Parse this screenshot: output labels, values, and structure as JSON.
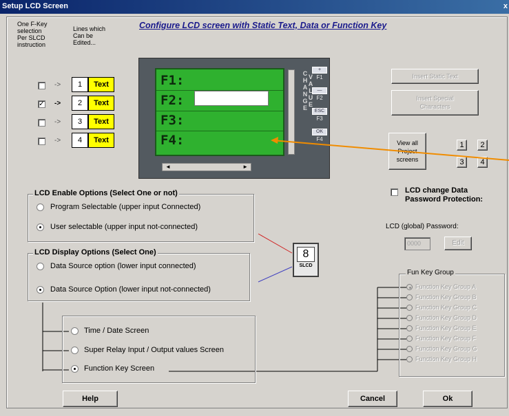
{
  "window": {
    "title": "Setup LCD Screen",
    "close_glyph": "x"
  },
  "header": {
    "fkey_note": [
      "One F-Key",
      "selection",
      "Per SLCD",
      "instruction"
    ],
    "lines_note": [
      "Lines which",
      "Can be",
      "Edited..."
    ],
    "main_title": "Configure LCD screen with Static Text, Data or Function Key"
  },
  "lines": [
    {
      "checked": false,
      "num": "1",
      "label": "Text"
    },
    {
      "checked": true,
      "num": "2",
      "label": "Text"
    },
    {
      "checked": false,
      "num": "3",
      "label": "Text"
    },
    {
      "checked": false,
      "num": "4",
      "label": "Text"
    }
  ],
  "lcd": {
    "lines": [
      "F1:",
      "F2:",
      "F3:",
      "F4:"
    ],
    "change_letters": [
      "C",
      "H",
      "A",
      "N",
      "G",
      "E"
    ],
    "value_letters": [
      "V",
      "A",
      "L",
      "U",
      "E"
    ],
    "fkeys": [
      "F1",
      "F2",
      "F3",
      "F4"
    ],
    "fkey_buttons": [
      "+",
      "—",
      "ESC",
      "OK"
    ],
    "hscroll_glyphs": [
      "◄",
      "►"
    ]
  },
  "right_buttons": {
    "insert_static": "Insert Static Text",
    "insert_special": [
      "Insert Special",
      "Characters"
    ],
    "view_all": [
      "View all",
      "Project",
      "screens"
    ],
    "screen_nums": [
      "1",
      "2",
      "3",
      "4"
    ]
  },
  "password": {
    "change_label": [
      "LCD change Data",
      "Password Protection:"
    ],
    "global_label": "LCD (global) Password:",
    "value": "0000",
    "edit_label": "Edit"
  },
  "enable_options": {
    "title": "LCD Enable Options (Select One or not)",
    "items": [
      {
        "label": "Program Selectable (upper input Connected)",
        "selected": false
      },
      {
        "label": "User selectable (upper input not-connected)",
        "selected": true
      }
    ]
  },
  "display_options": {
    "title": "LCD Display Options (Select One)",
    "items": [
      {
        "label": "Data Source option (lower input connected)",
        "selected": false
      },
      {
        "label": "Data Source Option (lower input not-connected)",
        "selected": true
      }
    ]
  },
  "slcd_block": {
    "digit": "8",
    "caption": "SLCD"
  },
  "screen_options": [
    {
      "label": "Time / Date Screen",
      "selected": false
    },
    {
      "label": "Super Relay Input / Output values Screen",
      "selected": false
    },
    {
      "label": "Function Key Screen",
      "selected": true
    }
  ],
  "fun_key_group": {
    "title": "Fun Key Group",
    "items": [
      {
        "label": "Function Key Group A",
        "selected": true
      },
      {
        "label": "Function Key Group B",
        "selected": false
      },
      {
        "label": "Function Key Group C",
        "selected": false
      },
      {
        "label": "Function Key Group D",
        "selected": false
      },
      {
        "label": "Function Key Group E",
        "selected": false
      },
      {
        "label": "Function Key Group F",
        "selected": false
      },
      {
        "label": "Function Key Group G",
        "selected": false
      },
      {
        "label": "Function Key Group H",
        "selected": false
      }
    ]
  },
  "footer": {
    "help": "Help",
    "cancel": "Cancel",
    "ok": "Ok"
  },
  "colors": {
    "arrow": "#f08c00",
    "red_wire": "#d02020",
    "blue_wire": "#4040c0",
    "lcd_green": "#2fb12f"
  }
}
